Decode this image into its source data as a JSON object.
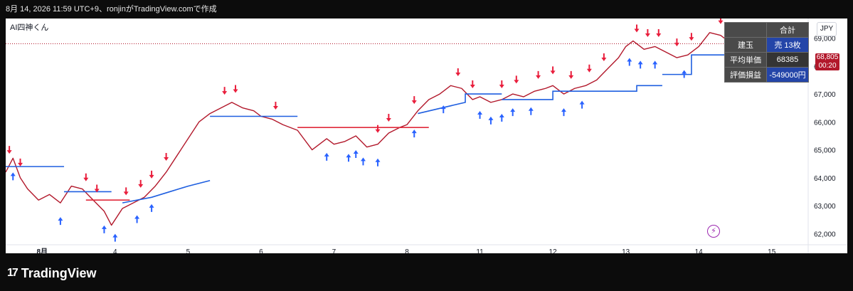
{
  "header": {
    "title": "8月 14, 2026 11:59 UTC+9、ronjinがTradingView.comで作成"
  },
  "indicator": {
    "name": "AI四神くん"
  },
  "currency": "JPY",
  "last_price": {
    "price": "68,805",
    "countdown": "00:20"
  },
  "table": {
    "header": "合計",
    "rows": [
      {
        "label": "建玉",
        "value": "売 13枚"
      },
      {
        "label": "平均単価",
        "value": "68385"
      },
      {
        "label": "評価損益",
        "value": "-549000円"
      }
    ]
  },
  "logo": {
    "mark": "17",
    "text": "TradingView"
  },
  "icons": {
    "bolt": "lightning-icon",
    "logo": "tradingview-logo-icon"
  },
  "colors": {
    "candle": "#b2182b",
    "support_line": "#1f5fe0",
    "flat_line": "#e0293a",
    "buy_arrow": "#2962ff",
    "sell_arrow": "#e91e3c"
  },
  "chart_data": {
    "type": "line",
    "title": "",
    "xlabel": "",
    "ylabel": "",
    "x_ticks": [
      {
        "label": "8月",
        "x": 0
      },
      {
        "label": "4",
        "x": 1
      },
      {
        "label": "5",
        "x": 2
      },
      {
        "label": "6",
        "x": 3
      },
      {
        "label": "7",
        "x": 4
      },
      {
        "label": "8",
        "x": 5
      },
      {
        "label": "11",
        "x": 6
      },
      {
        "label": "12",
        "x": 7
      },
      {
        "label": "13",
        "x": 8
      },
      {
        "label": "14",
        "x": 9
      },
      {
        "label": "15",
        "x": 10
      }
    ],
    "y_ticks": [
      "69,000",
      "68,000",
      "67,000",
      "66,000",
      "65,000",
      "64,000",
      "63,000",
      "62,000"
    ],
    "ylim": [
      61600,
      69500
    ],
    "xlim": [
      -0.5,
      10.5
    ],
    "series": [
      {
        "kind": "price",
        "x": [
          -0.5,
          -0.4,
          -0.3,
          -0.2,
          -0.05,
          0.1,
          0.25,
          0.4,
          0.55,
          0.7,
          0.85,
          0.95,
          1.0,
          1.1,
          1.25,
          1.4,
          1.55,
          1.7,
          1.85,
          2.0,
          2.15,
          2.3,
          2.45,
          2.6,
          2.75,
          2.9,
          3.0,
          3.15,
          3.3,
          3.5,
          3.7,
          3.9,
          4.0,
          4.15,
          4.3,
          4.45,
          4.6,
          4.75,
          4.9,
          5.0,
          5.15,
          5.3,
          5.45,
          5.6,
          5.75,
          5.9,
          6.0,
          6.15,
          6.3,
          6.45,
          6.6,
          6.75,
          6.9,
          7.0,
          7.15,
          7.3,
          7.45,
          7.6,
          7.75,
          7.9,
          8.0,
          8.1,
          8.25,
          8.4,
          8.55,
          8.7,
          8.85,
          9.0,
          9.15,
          9.3,
          9.4,
          9.45
        ],
        "y": [
          64200,
          64700,
          64000,
          63600,
          63200,
          63400,
          63100,
          63700,
          63600,
          63200,
          62800,
          62300,
          62500,
          62900,
          63100,
          63300,
          63700,
          64200,
          64800,
          65400,
          66000,
          66300,
          66500,
          66700,
          66500,
          66400,
          66200,
          66100,
          65900,
          65700,
          65000,
          65400,
          65200,
          65300,
          65500,
          65100,
          65200,
          65600,
          65800,
          65900,
          66400,
          66800,
          67000,
          67300,
          67200,
          66800,
          66900,
          66700,
          66800,
          67000,
          66900,
          67100,
          67200,
          67300,
          67000,
          67200,
          67300,
          67500,
          67900,
          68300,
          68700,
          68900,
          68600,
          68700,
          68500,
          68300,
          68400,
          68700,
          69200,
          69100,
          68900,
          68800
        ]
      },
      {
        "kind": "support",
        "segments": [
          {
            "x": [
              -0.5,
              0.3
            ],
            "y": [
              64400,
              64400
            ]
          },
          {
            "x": [
              0.3,
              0.95
            ],
            "y": [
              63500,
              63500
            ]
          },
          {
            "x": [
              1.1,
              1.5,
              1.75,
              2.0,
              2.3
            ],
            "y": [
              63100,
              63300,
              63500,
              63700,
              63900
            ]
          },
          {
            "x": [
              2.3,
              3.5
            ],
            "y": [
              66200,
              66200
            ]
          },
          {
            "x": [
              5.15,
              5.8,
              5.8,
              6.3
            ],
            "y": [
              66300,
              66700,
              67000,
              67000
            ]
          },
          {
            "x": [
              6.3,
              7.0,
              7.0,
              8.15,
              8.15,
              8.5
            ],
            "y": [
              66800,
              66800,
              67100,
              67100,
              67300,
              67300
            ]
          },
          {
            "x": [
              8.5,
              8.9,
              8.9,
              9.45
            ],
            "y": [
              67700,
              67700,
              68400,
              68400
            ]
          }
        ]
      },
      {
        "kind": "flat",
        "segments": [
          {
            "x": [
              3.5,
              5.3
            ],
            "y": [
              65800,
              65800
            ]
          },
          {
            "x": [
              0.6,
              1.2
            ],
            "y": [
              63200,
              63200
            ]
          }
        ]
      }
    ],
    "buy_signals_x": [
      -0.4,
      0.25,
      0.85,
      1.0,
      1.3,
      1.5,
      3.9,
      4.2,
      4.3,
      4.4,
      4.6,
      5.1,
      5.5,
      6.0,
      6.15,
      6.3,
      6.45,
      6.7,
      7.15,
      7.4,
      8.05,
      8.2,
      8.4,
      8.8
    ],
    "sell_signals_x": [
      -0.45,
      -0.3,
      0.6,
      0.75,
      1.15,
      1.35,
      1.5,
      1.7,
      2.5,
      2.65,
      3.2,
      4.6,
      4.75,
      5.1,
      5.7,
      5.9,
      6.3,
      6.5,
      6.8,
      7.0,
      7.25,
      7.5,
      7.7,
      8.15,
      8.3,
      8.45,
      8.7,
      8.9,
      9.3
    ]
  }
}
